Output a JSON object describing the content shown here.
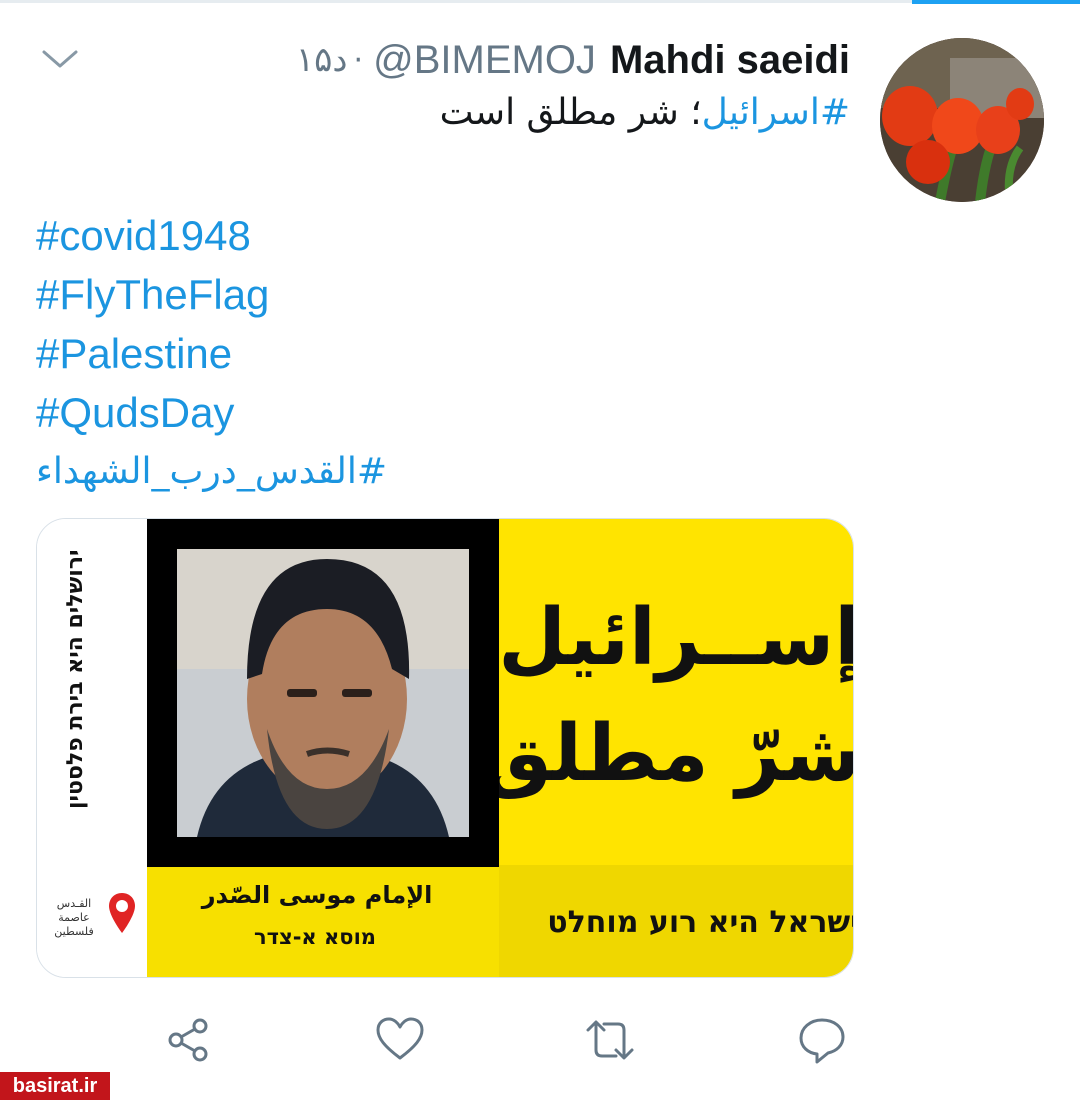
{
  "tweet": {
    "display_name": "Mahdi saeidi",
    "handle": "@BIMEMOJ",
    "separator": "·",
    "time": "۱۵د",
    "line1_hashtag": "#اسرائیل",
    "line1_rest": "؛ شر مطلق است",
    "hashtags": [
      "#covid1948",
      "#FlyTheFlag",
      "#Palestine",
      "#QudsDay",
      "#القدس_درب_الشهداء"
    ]
  },
  "card": {
    "vertical_hebrew": "ירושלים היא בירת פלסטין",
    "logo_text": [
      "القـدس",
      "عاصمة",
      "فلسطين"
    ],
    "caption_arabic": "الإمام موسى الصّدر",
    "caption_hebrew": "מוסא א-צדר",
    "headline_line1": "إســرائيل",
    "headline_line2": "شرّ مطلق",
    "bottom_hebrew": "ישראל היא רוע מוחלט"
  },
  "actions": [
    "share-icon",
    "like-icon",
    "retweet-icon",
    "reply-icon"
  ],
  "watermark": "basirat.ir",
  "colors": {
    "link": "#1b95e0",
    "accent": "#1da1f2",
    "poster_yellow": "#ffe400",
    "watermark_red": "#c2151b"
  }
}
